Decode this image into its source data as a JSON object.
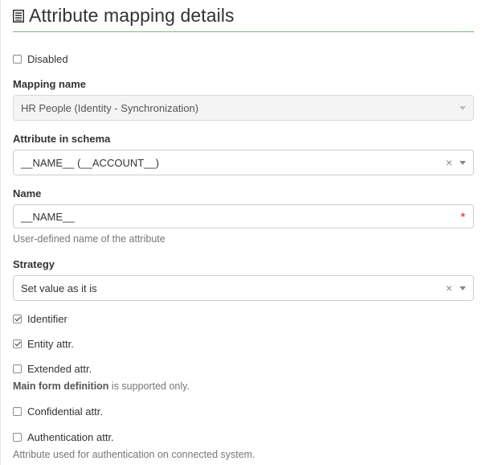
{
  "header": {
    "title": "Attribute mapping details",
    "icon": "document-list-icon"
  },
  "disabled": {
    "label": "Disabled",
    "checked": false
  },
  "mapping_name": {
    "label": "Mapping name",
    "value": "HR People (Identity - Synchronization)"
  },
  "attribute_in_schema": {
    "label": "Attribute in schema",
    "value": "__NAME__ (__ACCOUNT__)",
    "clear_glyph": "×"
  },
  "name": {
    "label": "Name",
    "value": "__NAME__",
    "required_marker": "*",
    "help": "User-defined name of the attribute"
  },
  "strategy": {
    "label": "Strategy",
    "value": "Set value as it is",
    "clear_glyph": "×"
  },
  "identifier": {
    "label": "Identifier",
    "checked": true
  },
  "entity_attr": {
    "label": "Entity attr.",
    "checked": true
  },
  "extended_attr": {
    "label": "Extended attr.",
    "checked": false,
    "help_bold": "Main form definition",
    "help_rest": " is supported only."
  },
  "confidential_attr": {
    "label": "Confidential attr.",
    "checked": false
  },
  "authentication_attr": {
    "label": "Authentication attr.",
    "checked": false,
    "help": "Attribute used for authentication on connected system."
  },
  "colors": {
    "header_rule": "#7cb87c",
    "required": "#d9534f",
    "help_text": "#777777"
  }
}
